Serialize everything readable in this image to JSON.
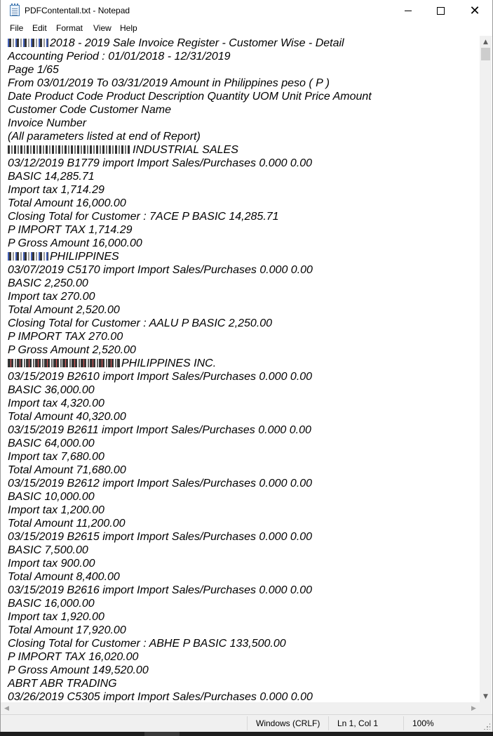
{
  "window": {
    "title": "PDFContentall.txt - Notepad",
    "icon": "notepad-icon"
  },
  "menu": [
    "File",
    "Edit",
    "Format",
    "View",
    "Help"
  ],
  "document": {
    "lines": [
      {
        "redact": "mixed",
        "text": "2018 - 2019 Sale Invoice Register - Customer Wise - Detail"
      },
      {
        "text": "Accounting Period : 01/01/2018 - 12/31/2019"
      },
      {
        "text": "Page 1/65"
      },
      {
        "text": "From 03/01/2019 To 03/31/2019 Amount in Philippines peso ( P )"
      },
      {
        "text": "Date Product Code Product Description Quantity UOM Unit Price Amount"
      },
      {
        "text": "Customer Code Customer Name"
      },
      {
        "text": "Invoice Number"
      },
      {
        "text": "(All parameters listed at end of Report)"
      },
      {
        "redact": "plain",
        "text": "INDUSTRIAL SALES"
      },
      {
        "text": "03/12/2019 B1779 import Import Sales/Purchases 0.000 0.00"
      },
      {
        "text": "BASIC 14,285.71"
      },
      {
        "text": "Import tax 1,714.29"
      },
      {
        "text": "Total Amount 16,000.00"
      },
      {
        "text": "Closing Total for Customer : 7ACE P BASIC 14,285.71"
      },
      {
        "text": "P IMPORT TAX 1,714.29"
      },
      {
        "text": "P Gross Amount 16,000.00"
      },
      {
        "redact": "mixed",
        "text": "PHILIPPINES"
      },
      {
        "text": "03/07/2019 C5170 import Import Sales/Purchases 0.000 0.00"
      },
      {
        "text": "BASIC 2,250.00"
      },
      {
        "text": "Import tax 270.00"
      },
      {
        "text": "Total Amount 2,520.00"
      },
      {
        "text": "Closing Total for Customer : AALU P BASIC 2,250.00"
      },
      {
        "text": "P IMPORT TAX 270.00"
      },
      {
        "text": "P Gross Amount 2,520.00"
      },
      {
        "redact": "dense",
        "text": "PHILIPPINES INC."
      },
      {
        "text": "03/15/2019 B2610 import Import Sales/Purchases 0.000 0.00"
      },
      {
        "text": "BASIC 36,000.00"
      },
      {
        "text": "Import tax 4,320.00"
      },
      {
        "text": "Total Amount 40,320.00"
      },
      {
        "text": "03/15/2019 B2611 import Import Sales/Purchases 0.000 0.00"
      },
      {
        "text": "BASIC 64,000.00"
      },
      {
        "text": "Import tax 7,680.00"
      },
      {
        "text": "Total Amount 71,680.00"
      },
      {
        "text": "03/15/2019 B2612 import Import Sales/Purchases 0.000 0.00"
      },
      {
        "text": "BASIC 10,000.00"
      },
      {
        "text": "Import tax 1,200.00"
      },
      {
        "text": "Total Amount 11,200.00"
      },
      {
        "text": "03/15/2019 B2615 import Import Sales/Purchases 0.000 0.00"
      },
      {
        "text": "BASIC 7,500.00"
      },
      {
        "text": "Import tax 900.00"
      },
      {
        "text": "Total Amount 8,400.00"
      },
      {
        "text": "03/15/2019 B2616 import Import Sales/Purchases 0.000 0.00"
      },
      {
        "text": "BASIC 16,000.00"
      },
      {
        "text": "Import tax 1,920.00"
      },
      {
        "text": "Total Amount 17,920.00"
      },
      {
        "text": "Closing Total for Customer : ABHE P BASIC 133,500.00"
      },
      {
        "text": "P IMPORT TAX 16,020.00"
      },
      {
        "text": "P Gross Amount 149,520.00"
      },
      {
        "text": "ABRT ABR TRADING"
      },
      {
        "text": "03/26/2019 C5305 import Import Sales/Purchases 0.000 0.00"
      }
    ]
  },
  "status": {
    "encoding": "Windows (CRLF)",
    "position": "Ln 1, Col 1",
    "zoom": "100%"
  }
}
